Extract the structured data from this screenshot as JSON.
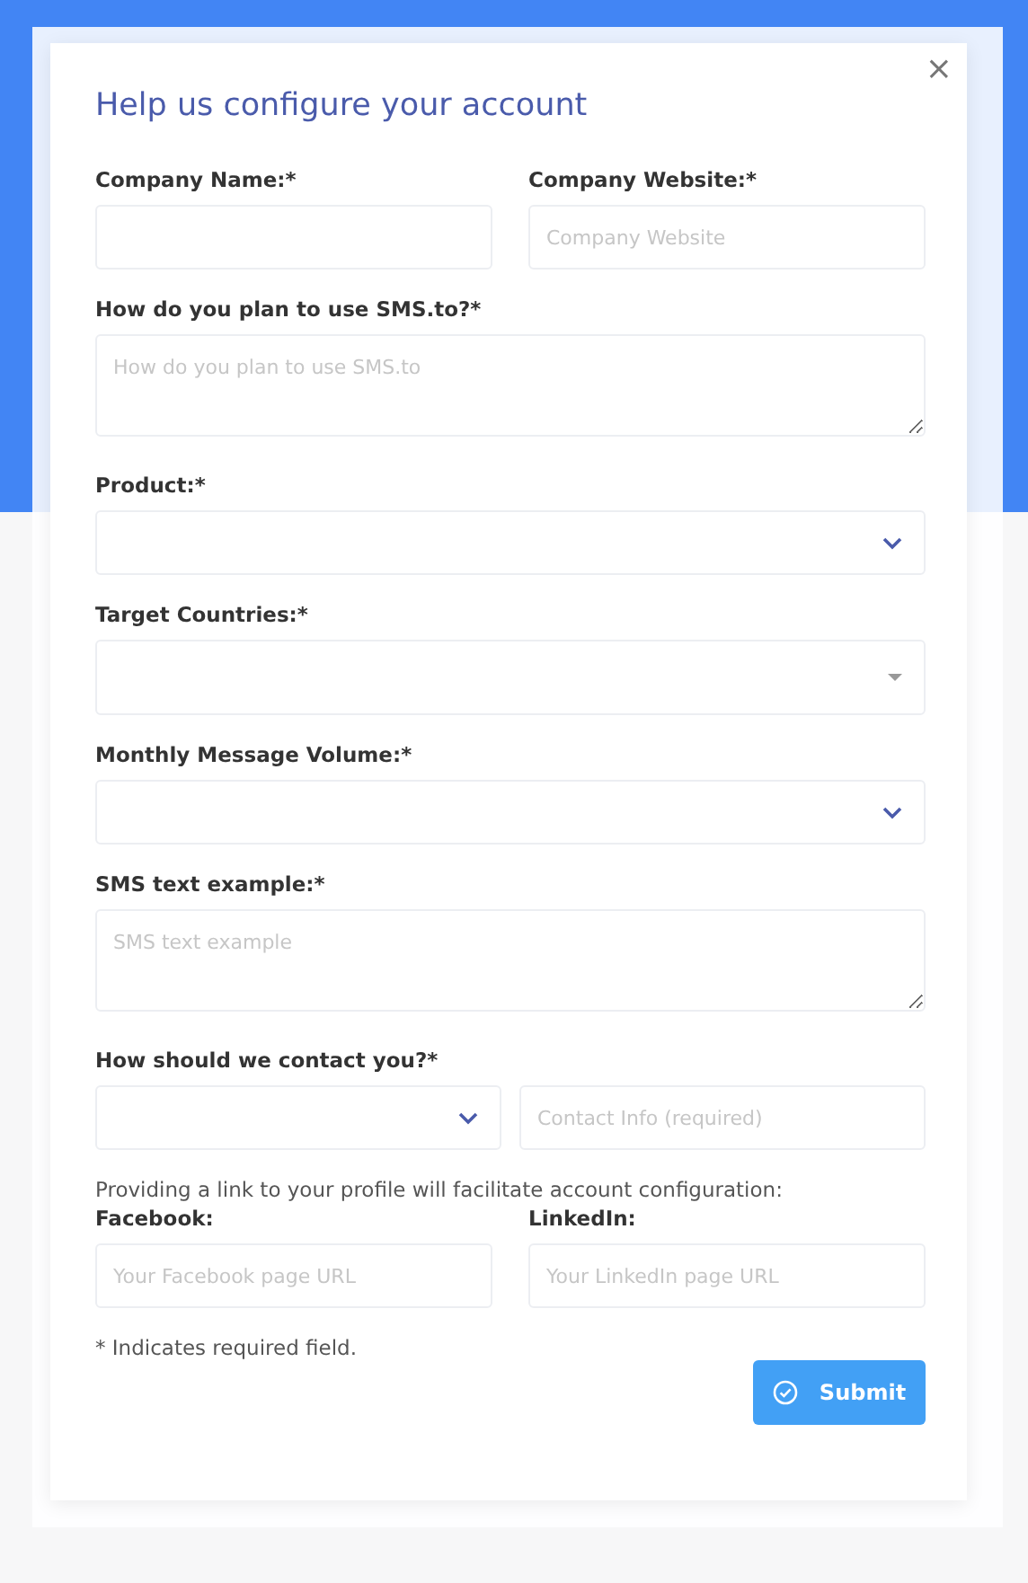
{
  "dialog": {
    "title": "Help us configure your account",
    "close": "×"
  },
  "groups": [
    {
      "fields": [
        {
          "kind": "input",
          "label": "Company Name:*"
        },
        {
          "kind": "input",
          "label": "Company Website:*",
          "placeholder": "Company Website"
        }
      ]
    },
    {
      "fields": [
        {
          "kind": "textarea",
          "label": "How do you plan to use SMS.to?*",
          "placeholder": "How do you plan to use SMS.to"
        }
      ]
    },
    {
      "fields": [
        {
          "kind": "select",
          "label": "Product:*"
        }
      ]
    },
    {
      "fields": [
        {
          "kind": "multiselect",
          "label": "Target Countries:*"
        }
      ]
    },
    {
      "fields": [
        {
          "kind": "select",
          "label": "Monthly Message Volume:*"
        }
      ]
    },
    {
      "fields": [
        {
          "kind": "textarea",
          "label": "SMS text example:*",
          "placeholder": "SMS text example"
        }
      ]
    },
    {
      "label": "How should we contact you?*",
      "fields": [
        {
          "kind": "select"
        },
        {
          "kind": "input",
          "placeholder": "Contact Info (required)"
        }
      ]
    },
    {
      "note": "Providing a link to your profile will facilitate account configuration:",
      "fields": [
        {
          "kind": "input",
          "label": "Facebook:",
          "placeholder": "Your Facebook page URL"
        },
        {
          "kind": "input",
          "label": "LinkedIn:",
          "placeholder": "Your LinkedIn page URL"
        }
      ]
    }
  ],
  "footnote": "* Indicates required field.",
  "submit": {
    "label": "Submit"
  }
}
